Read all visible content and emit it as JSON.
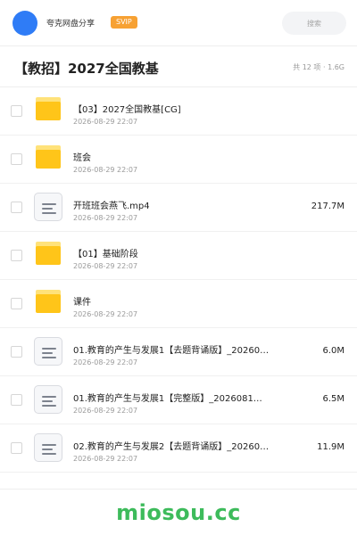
{
  "header": {
    "user_name": "夸克网盘分享",
    "badge": "SVIP",
    "search_placeholder": "搜索",
    "accent_color": "#2f7cf6",
    "badge_color": "#f7a133"
  },
  "folder": {
    "title": "【教招】2027全国教基",
    "meta": "共 12 项 · 1.6G"
  },
  "items": [
    {
      "type": "folder",
      "icon": "folder-icon",
      "name": "【03】2027全国教基[CG]",
      "date": "2026-08-29 22:07",
      "size": ""
    },
    {
      "type": "folder",
      "icon": "folder-icon",
      "name": "班会",
      "date": "2026-08-29 22:07",
      "size": ""
    },
    {
      "type": "file",
      "icon": "video-file-icon",
      "name": "开班班会燕飞.mp4",
      "date": "2026-08-29 22:07",
      "size": "217.7M"
    },
    {
      "type": "folder",
      "icon": "folder-icon",
      "name": "【01】基础阶段",
      "date": "2026-08-29 22:07",
      "size": ""
    },
    {
      "type": "folder",
      "icon": "folder-icon",
      "name": "课件",
      "date": "2026-08-29 22:07",
      "size": ""
    },
    {
      "type": "file",
      "icon": "document-file-icon",
      "name": "01.教育的产生与发展1【去题背诵版】_20260…",
      "date": "2026-08-29 22:07",
      "size": "6.0M"
    },
    {
      "type": "file",
      "icon": "document-file-icon",
      "name": "01.教育的产生与发展1【完整版】_2026081…",
      "date": "2026-08-29 22:07",
      "size": "6.5M"
    },
    {
      "type": "file",
      "icon": "document-file-icon",
      "name": "02.教育的产生与发展2【去题背诵版】_20260…",
      "date": "2026-08-29 22:07",
      "size": "11.9M"
    }
  ],
  "footer": {
    "brand": "miosou.cc",
    "brand_color": "#3dbb5b"
  }
}
